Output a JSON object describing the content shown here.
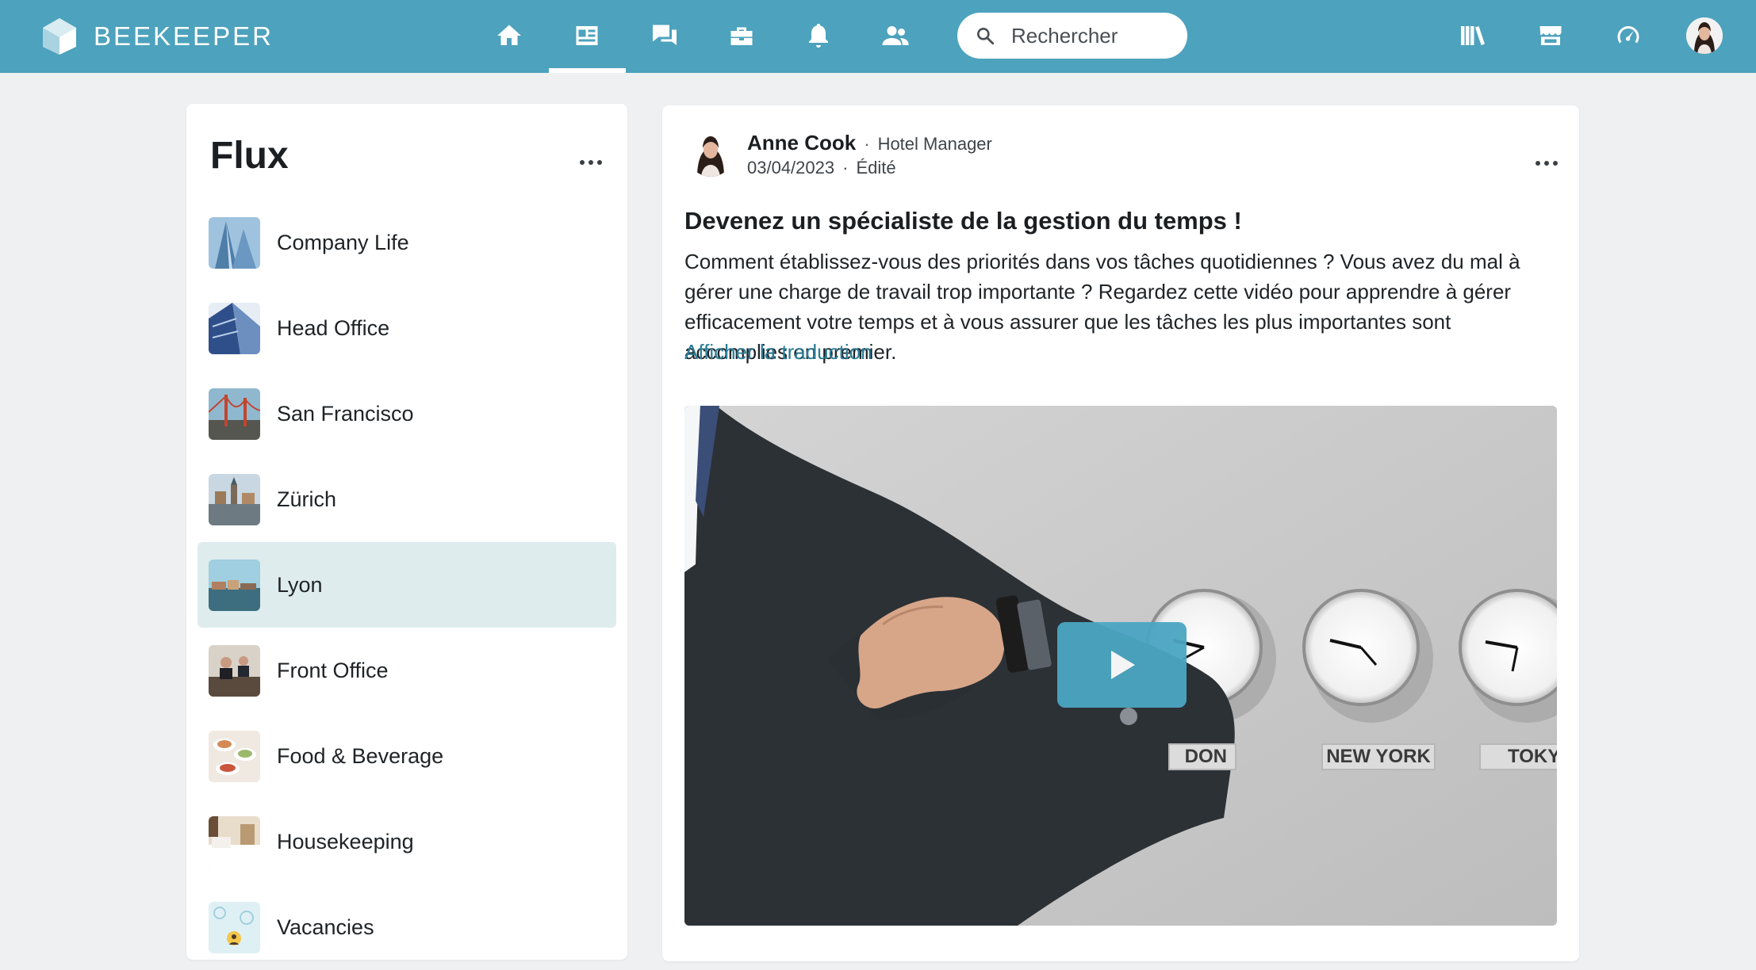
{
  "brand": {
    "name": "BEEKEEPER"
  },
  "nav": {
    "items": [
      {
        "icon": "home-icon"
      },
      {
        "icon": "news-feed-icon"
      },
      {
        "icon": "chat-icon"
      },
      {
        "icon": "toolbox-icon"
      },
      {
        "icon": "bell-icon"
      },
      {
        "icon": "people-icon"
      }
    ],
    "active_index": 1,
    "search": {
      "placeholder": "Rechercher",
      "icon": "search-icon"
    },
    "right_icons": [
      "library-icon",
      "store-icon",
      "speedometer-icon"
    ],
    "colors": {
      "bar": "#4da2bd",
      "active_row": "#deecee",
      "link": "#2a7d97",
      "play": "#4ba6c3"
    }
  },
  "sidebar": {
    "title": "Flux",
    "items": [
      {
        "label": "Company Life"
      },
      {
        "label": "Head Office"
      },
      {
        "label": "San Francisco"
      },
      {
        "label": "Zürich"
      },
      {
        "label": "Lyon"
      },
      {
        "label": "Front Office"
      },
      {
        "label": "Food & Beverage"
      },
      {
        "label": "Housekeeping"
      },
      {
        "label": "Vacancies"
      }
    ],
    "active_item": "Lyon"
  },
  "post": {
    "author": "Anne Cook",
    "role": "Hotel Manager",
    "date": "03/04/2023",
    "edited": "Édité",
    "title": "Devenez un spécialiste de la gestion du temps !",
    "body": "Comment établissez-vous des priorités dans vos tâches quotidiennes ? Vous avez du mal à gérer une charge de travail trop importante ? Regardez cette vidéo pour apprendre à gérer efficacement votre temps et à vous assurer que les tâches les plus importantes sont accomplies en premier.",
    "translate_link": "Afficher la traduction",
    "video": {
      "clock_labels": [
        "DON",
        "NEW YORK",
        "TOKY"
      ]
    }
  }
}
